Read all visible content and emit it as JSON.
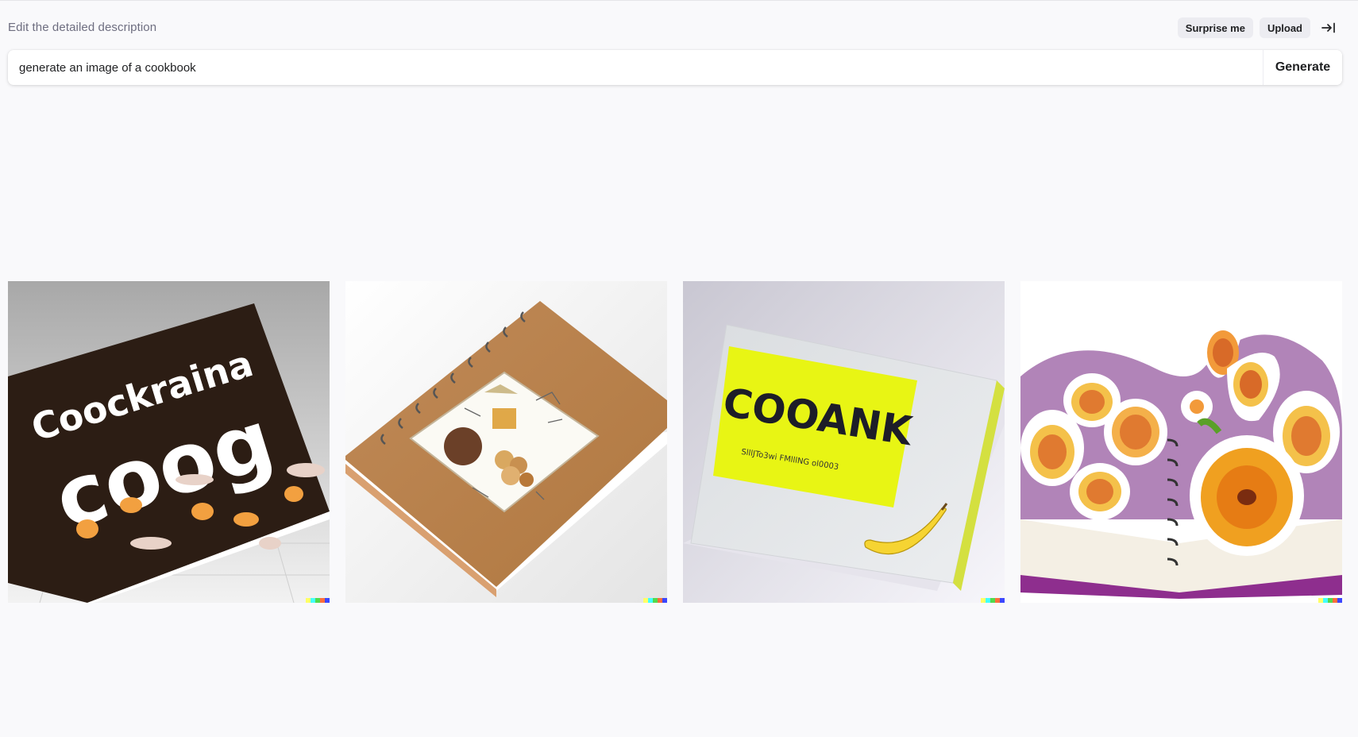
{
  "header": {
    "label": "Edit the detailed description",
    "surprise_label": "Surprise me",
    "upload_label": "Upload",
    "collapse_icon": "collapse-right-icon"
  },
  "prompt": {
    "value": "generate an image of a cookbook",
    "generate_label": "Generate"
  },
  "results": [
    {
      "name": "cookbook-image-1",
      "art_text_top": "Coockraina",
      "art_text_main": "coog"
    },
    {
      "name": "cookbook-image-2"
    },
    {
      "name": "cookbook-image-3",
      "art_text_main": "COOANK",
      "art_text_sub": "SlllJTo3wi FMlllNG ol0003"
    },
    {
      "name": "cookbook-image-4"
    }
  ],
  "signature_colors": [
    "#ffff66",
    "#42ffff",
    "#51da4c",
    "#ff6e3c",
    "#3c46ff"
  ]
}
